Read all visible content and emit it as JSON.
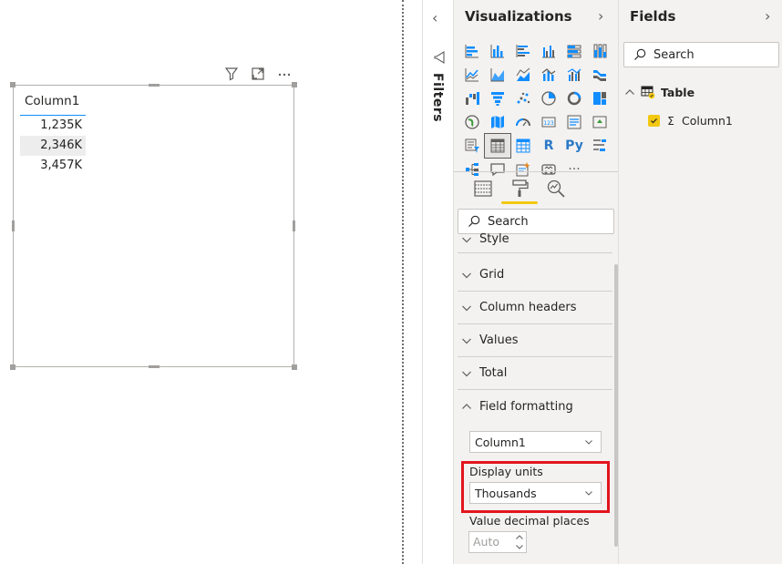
{
  "canvas": {
    "visual": {
      "header_icons": [
        "filter-icon",
        "focus-mode-icon",
        "more-options-icon"
      ],
      "table": {
        "column_header": "Column1",
        "rows": [
          "1,235K",
          "2,346K",
          "3,457K"
        ]
      }
    }
  },
  "filters": {
    "label": "Filters",
    "collapse_glyph": "‹"
  },
  "visualizations": {
    "title": "Visualizations",
    "expand_glyph": "›",
    "search_placeholder": "Search",
    "r_visual_label": "R",
    "python_visual_label": "Py",
    "more_visuals_label": "···",
    "sections": [
      {
        "label": "Style",
        "expanded": false
      },
      {
        "label": "Grid",
        "expanded": false
      },
      {
        "label": "Column headers",
        "expanded": false
      },
      {
        "label": "Values",
        "expanded": false
      },
      {
        "label": "Total",
        "expanded": false
      },
      {
        "label": "Field formatting",
        "expanded": true
      }
    ],
    "field_formatting": {
      "field_value": "Column1",
      "display_units_label": "Display units",
      "display_units_value": "Thousands",
      "decimal_places_label": "Value decimal places",
      "decimal_places_value": "Auto"
    },
    "accent_color": "#f2c811",
    "highlight_color": "#e3141e"
  },
  "fields": {
    "title": "Fields",
    "expand_glyph": "›",
    "search_placeholder": "Search",
    "table_name": "Table",
    "field_name": "Column1",
    "field_type_glyph": "Σ"
  }
}
